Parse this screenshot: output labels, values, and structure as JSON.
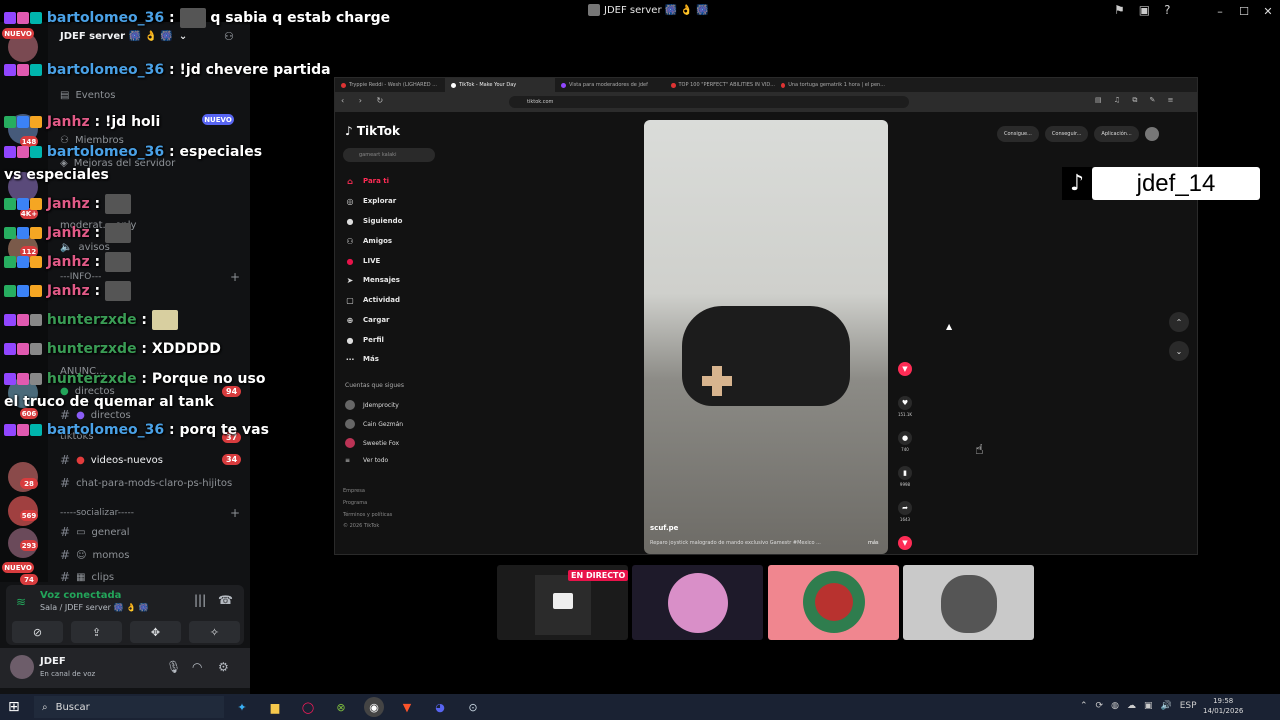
{
  "window": {
    "title": "JDEF server 🎆 👌 🎆",
    "controls": [
      "–",
      "☐",
      "✕"
    ]
  },
  "server": {
    "name": "JDEF server 🎆 👌 🎆",
    "nuevo_badge_1": "NUEVO",
    "nuevo_badge_2": "NUEVO",
    "nuevo_badge_3": "NUEVO",
    "events_label": "Eventos",
    "members_label": "Miembros",
    "boosts_label": "Mejoras del servidor",
    "guild_badges": [
      "148",
      "4K+",
      "112",
      "606",
      "28",
      "569",
      "293",
      "74"
    ]
  },
  "channels": {
    "cat_moderation": "moderat... only",
    "avisos": "avisos",
    "info_cat": "---INFO---",
    "anunc": "ANUNC...",
    "cat_directos": "directos",
    "directos_badge": "94",
    "directos": "directos",
    "tiktoks": "tiktoks",
    "tiktoks_badge": "37",
    "videos_nuevos": "videos-nuevos",
    "videos_badge": "34",
    "mods_chat": "chat-para-mods-claro-ps-hijitos",
    "cat_socializar": "-----socializar-----",
    "general": "general",
    "momos": "momos",
    "clips": "clips"
  },
  "voice": {
    "status": "Voz conectada",
    "sub": "Sala / JDEF server 🎆 👌 🎆"
  },
  "user": {
    "name": "JDEF",
    "status": "En canal de voz"
  },
  "chat": [
    {
      "user": "bartolomeo_36",
      "text": "q sabia q estab charge",
      "color": "blue"
    },
    {
      "user": "bartolomeo_36",
      "text": "!jd chevere partida",
      "color": "blue"
    },
    {
      "user": "Janhz",
      "text": "!jd holi",
      "color": "pink"
    },
    {
      "user": "bartolomeo_36",
      "text": "especiales vs especiales",
      "color": "blue"
    },
    {
      "user": "Janhz",
      "text": "",
      "color": "pink"
    },
    {
      "user": "Janhz",
      "text": "",
      "color": "pink"
    },
    {
      "user": "Janhz",
      "text": "",
      "color": "pink"
    },
    {
      "user": "Janhz",
      "text": "",
      "color": "pink"
    },
    {
      "user": "hunterzxde",
      "text": "",
      "color": "green"
    },
    {
      "user": "hunterzxde",
      "text": "XDDDDD",
      "color": "green"
    },
    {
      "user": "hunterzxde",
      "text": "Porque no uso el truco de quemar al tank",
      "color": "green"
    },
    {
      "user": "bartolomeo_36",
      "text": "porq te vas",
      "color": "blue"
    }
  ],
  "browser": {
    "tabs": [
      "Tryppie Reddi - Wesh (LIGHARED ...",
      "TikTok - Make Your Day",
      "Vista para moderadores de jdef",
      "TOP 100 \"PERFECT\" ABILITIES IN VID...",
      "Una tortuga gematrik 1 hora | el pen..."
    ],
    "url": "tiktok.com"
  },
  "tiktok": {
    "logo": "TikTok",
    "search_placeholder": "gameart kalaki",
    "nav": [
      "Para ti",
      "Explorar",
      "Siguiendo",
      "Amigos",
      "LIVE",
      "Mensajes",
      "Actividad",
      "Cargar",
      "Perfil",
      "Más"
    ],
    "following_title": "Cuentas que sigues",
    "following": [
      "Jdemprocity",
      "Cain Gezmán",
      "Sweetie Fox",
      "Ver todo"
    ],
    "footer": [
      "Empresa",
      "Programa",
      "Términos y políticas",
      "© 2026 TikTok"
    ],
    "top_buttons": [
      "Consigue...",
      "Conseguir...",
      "Aplicación..."
    ],
    "video_author": "scuf.pe",
    "video_desc": "Reparo joystick malogrado de mando exclusivo Gamestr #Mexico ...",
    "video_more": "más",
    "likes": "151.1K",
    "comments": "740",
    "saves": "9998",
    "shares": "1643"
  },
  "overlay": {
    "tag_name": "jdef_14"
  },
  "thumbnails": {
    "live_badge": "EN DIRECTO"
  },
  "taskbar": {
    "search": "Buscar",
    "lang": "ESP",
    "time": "19:58",
    "date": "14/01/2026"
  },
  "colors": {
    "discord_bg": "#111214",
    "tiktok_red": "#fe2c55",
    "voice_green": "#23a55a",
    "badge_red": "#d83c3e"
  }
}
